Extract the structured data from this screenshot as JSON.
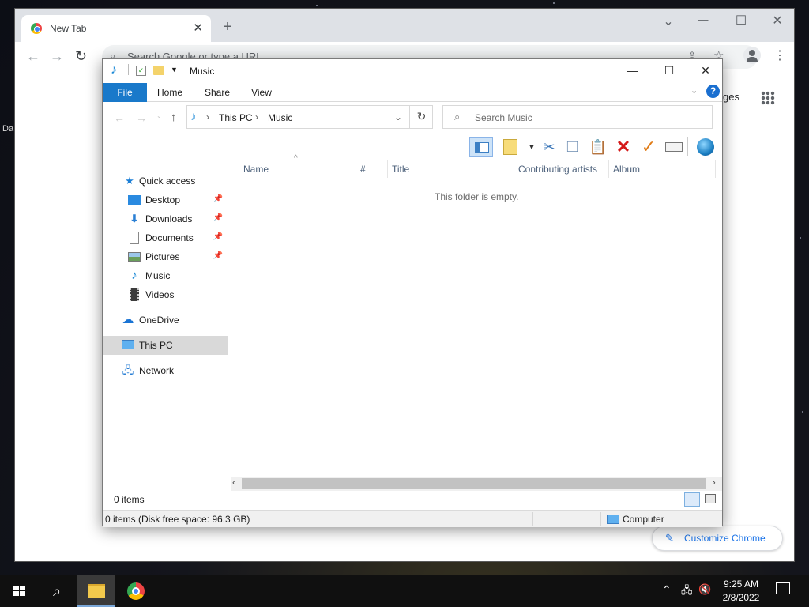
{
  "desktop": {
    "side_text": "Da"
  },
  "chrome": {
    "tab_title": "New Tab",
    "tab_close": "✕",
    "new_tab": "+",
    "window_controls": {
      "dropdown": "⌄",
      "minimize": "—",
      "maximize": "☐",
      "close": "✕"
    },
    "omnibox_placeholder": "Search Google or type a URL",
    "ntp_link_partial": "ges",
    "customize_label": "Customize Chrome"
  },
  "explorer": {
    "title": "Music",
    "ribbon_tabs": [
      "File",
      "Home",
      "Share",
      "View"
    ],
    "breadcrumb": [
      "This PC",
      "Music"
    ],
    "search_placeholder": "Search Music",
    "columns": [
      "Name",
      "#",
      "Title",
      "Contributing artists",
      "Album"
    ],
    "empty_message": "This folder is empty.",
    "nav": {
      "quick_access": "Quick access",
      "desktop": "Desktop",
      "downloads": "Downloads",
      "documents": "Documents",
      "pictures": "Pictures",
      "music": "Music",
      "videos": "Videos",
      "onedrive": "OneDrive",
      "this_pc": "This PC",
      "network": "Network"
    },
    "status_items": "0 items",
    "details_text": "0 items (Disk free space: 96.3 GB)",
    "details_location": "Computer"
  },
  "taskbar": {
    "time": "9:25 AM",
    "date": "2/8/2022"
  },
  "colors": {
    "file_tab": "#1979ca",
    "selected_nav": "#d9d9d9",
    "accent_link": "#1a73e8"
  }
}
